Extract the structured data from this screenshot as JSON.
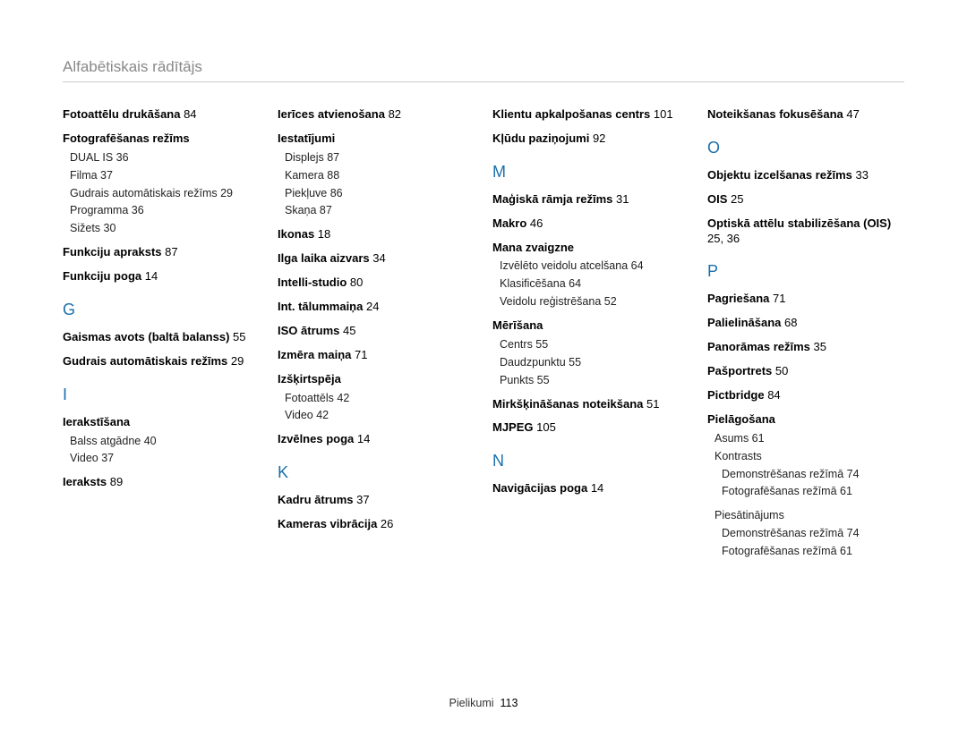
{
  "page_title": "Alfabētiskais rādītājs",
  "footer_label": "Pielikumi",
  "footer_page": "113",
  "columns": [
    [
      {
        "t": "bold",
        "text": "Fotoattēlu drukāšana",
        "pg": "84"
      },
      {
        "t": "bold",
        "text": "Fotografēšanas režīms"
      },
      {
        "t": "sub",
        "text": "DUAL IS",
        "pg": "36"
      },
      {
        "t": "sub",
        "text": "Filma",
        "pg": "37"
      },
      {
        "t": "sub",
        "text": "Gudrais automātiskais režīms",
        "pg": "29"
      },
      {
        "t": "sub",
        "text": "Programma",
        "pg": "36"
      },
      {
        "t": "sub",
        "text": "Sižets",
        "pg": "30",
        "gap": true
      },
      {
        "t": "bold",
        "text": "Funkciju apraksts",
        "pg": "87"
      },
      {
        "t": "bold",
        "text": "Funkciju poga",
        "pg": "14"
      },
      {
        "t": "letter",
        "text": "G"
      },
      {
        "t": "bold",
        "text": "Gaismas avots (baltā balanss)",
        "pg": "55"
      },
      {
        "t": "bold",
        "text": "Gudrais automātiskais režīms",
        "pg": "29"
      },
      {
        "t": "letter",
        "text": "I"
      },
      {
        "t": "bold",
        "text": "Ierakstīšana"
      },
      {
        "t": "sub",
        "text": "Balss atgādne",
        "pg": "40"
      },
      {
        "t": "sub",
        "text": "Video",
        "pg": "37",
        "gap": true
      },
      {
        "t": "bold",
        "text": "Ieraksts",
        "pg": "89"
      }
    ],
    [
      {
        "t": "bold",
        "text": "Ierīces atvienošana",
        "pg": "82"
      },
      {
        "t": "bold",
        "text": "Iestatījumi"
      },
      {
        "t": "sub",
        "text": "Displejs",
        "pg": "87"
      },
      {
        "t": "sub",
        "text": "Kamera",
        "pg": "88"
      },
      {
        "t": "sub",
        "text": "Piekļuve",
        "pg": "86"
      },
      {
        "t": "sub",
        "text": "Skaņa",
        "pg": "87",
        "gap": true
      },
      {
        "t": "bold",
        "text": "Ikonas",
        "pg": "18"
      },
      {
        "t": "bold",
        "text": "Ilga laika aizvars",
        "pg": "34"
      },
      {
        "t": "bold",
        "text": "Intelli-studio",
        "pg": "80"
      },
      {
        "t": "bold",
        "text": "Int. tālummaiņa",
        "pg": "24"
      },
      {
        "t": "bold",
        "text": "ISO ātrums",
        "pg": "45"
      },
      {
        "t": "bold",
        "text": "Izmēra maiņa",
        "pg": "71"
      },
      {
        "t": "bold",
        "text": "Izšķirtspēja"
      },
      {
        "t": "sub",
        "text": "Fotoattēls",
        "pg": "42"
      },
      {
        "t": "sub",
        "text": "Video",
        "pg": "42",
        "gap": true
      },
      {
        "t": "bold",
        "text": "Izvēlnes poga",
        "pg": "14"
      },
      {
        "t": "letter",
        "text": "K"
      },
      {
        "t": "bold",
        "text": "Kadru ātrums",
        "pg": "37"
      },
      {
        "t": "bold",
        "text": "Kameras vibrācija",
        "pg": "26"
      }
    ],
    [
      {
        "t": "bold",
        "text": "Klientu apkalpošanas centrs",
        "pg": "101"
      },
      {
        "t": "bold",
        "text": "Kļūdu paziņojumi",
        "pg": "92"
      },
      {
        "t": "letter",
        "text": "M"
      },
      {
        "t": "bold",
        "text": "Maģiskā rāmja režīms",
        "pg": "31"
      },
      {
        "t": "bold",
        "text": "Makro",
        "pg": "46"
      },
      {
        "t": "bold",
        "text": "Mana zvaigzne"
      },
      {
        "t": "sub",
        "text": "Izvēlēto veidolu atcelšana",
        "pg": "64"
      },
      {
        "t": "sub",
        "text": "Klasificēšana",
        "pg": "64"
      },
      {
        "t": "sub",
        "text": "Veidolu reģistrēšana",
        "pg": "52",
        "gap": true
      },
      {
        "t": "bold",
        "text": "Mērīšana"
      },
      {
        "t": "sub",
        "text": "Centrs",
        "pg": "55"
      },
      {
        "t": "sub",
        "text": "Daudzpunktu",
        "pg": "55"
      },
      {
        "t": "sub",
        "text": "Punkts",
        "pg": "55",
        "gap": true
      },
      {
        "t": "bold",
        "text": "Mirkšķināšanas noteikšana",
        "pg": "51"
      },
      {
        "t": "bold",
        "text": "MJPEG",
        "pg": "105"
      },
      {
        "t": "letter",
        "text": "N"
      },
      {
        "t": "bold",
        "text": "Navigācijas poga",
        "pg": "14"
      }
    ],
    [
      {
        "t": "bold",
        "text": "Noteikšanas fokusēšana",
        "pg": "47"
      },
      {
        "t": "letter",
        "text": "O"
      },
      {
        "t": "bold",
        "text": "Objektu izcelšanas režīms",
        "pg": "33"
      },
      {
        "t": "bold",
        "text": "OIS",
        "pg": "25"
      },
      {
        "t": "bold",
        "text": "Optiskā attēlu stabilizēšana (OIS)",
        "pg": "25, 36"
      },
      {
        "t": "letter",
        "text": "P"
      },
      {
        "t": "bold",
        "text": "Pagriešana",
        "pg": "71"
      },
      {
        "t": "bold",
        "text": "Palielināšana",
        "pg": "68"
      },
      {
        "t": "bold",
        "text": "Panorāmas režīms",
        "pg": "35"
      },
      {
        "t": "bold",
        "text": "Pašportrets",
        "pg": "50"
      },
      {
        "t": "bold",
        "text": "Pictbridge",
        "pg": "84"
      },
      {
        "t": "bold",
        "text": "Pielāgošana"
      },
      {
        "t": "sub",
        "text": "Asums",
        "pg": "61"
      },
      {
        "t": "sub",
        "text": "Kontrasts"
      },
      {
        "t": "sub2",
        "text": "Demonstrēšanas režīmā",
        "pg": "74"
      },
      {
        "t": "sub2",
        "text": "Fotografēšanas režīmā",
        "pg": "61",
        "gap": true
      },
      {
        "t": "sub",
        "text": "Piesātinājums"
      },
      {
        "t": "sub2",
        "text": "Demonstrēšanas režīmā",
        "pg": "74"
      },
      {
        "t": "sub2",
        "text": "Fotografēšanas režīmā",
        "pg": "61"
      }
    ]
  ]
}
